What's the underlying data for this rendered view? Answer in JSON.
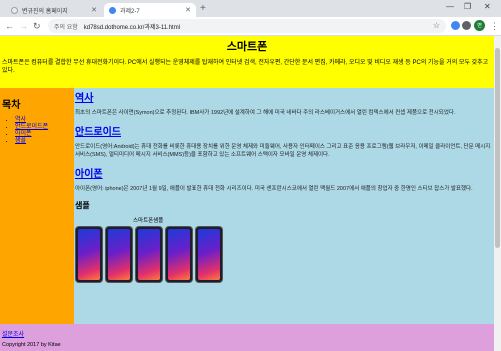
{
  "browser": {
    "tabs": [
      {
        "label": "변규진의 홈페이지",
        "active": false
      },
      {
        "label": "과제2-7",
        "active": true
      }
    ],
    "new_tab_label": "+",
    "security_label": "주의 요함",
    "url": "kd78sd.dothome.co.kr/과제3-11.html",
    "profile_initial": "변"
  },
  "page": {
    "title": "스마트폰",
    "intro": "스마트폰은 컴퓨터를 결합한 무선 휴대전화기이다. PC에서 실행되는 운영체제를 탑재하여 인터넷 검색, 전자우편, 간단한 문서 편집, 카메라, 오디오 및 비디오 재생 등 PC의 기능을 거의 모두 갖추고 있다.",
    "sidebar": {
      "heading": "목차",
      "items": [
        "역사",
        "안드로이드폰",
        "아이폰",
        "샘플"
      ]
    },
    "sections": [
      {
        "title": "역사",
        "text": "최초의 스마트폰은 사이먼(Symon)으로 추정된다. IBM사가 1992년에 설계하여 그 해에 미국 네바다 주의 라스베이거스에서 열린 컴덱스에서 컨셉 제품으로 전시되었다."
      },
      {
        "title": "안드로이드",
        "text": "안드로이드(영어:Android)는 휴대 전화를 비롯한 휴대용 장치를 위한 운영 체제와 미들웨어, 사용자 인터페이스 그리고 표준 응용 프로그램(웹 브라우저, 이메일 클라이언트, 단문 메시지 서비스(SMS), 멀티미디어 메시지 서비스(MMS)등)을 포함하고 있는 소프트웨어 스택이자 모바일 운영 체제이다."
      },
      {
        "title": "아이폰",
        "text": "아이폰(영어: iphone)은 2007년 1월 9일, 애플이 발표한 휴대 전화 시리즈이다. 미국 샌프란시스코에서 열린 맥월드 2007에서 애플의 창업자 중 한명인 스티브 잡스가 발표했다."
      }
    ],
    "sample": {
      "heading": "샘플",
      "caption": "스마트폰샘플"
    },
    "footer": {
      "link": "설문조사",
      "copyright": "Copyright 2017 by Kitae"
    }
  },
  "colors": {
    "header": "#ffff00",
    "sidebar": "#ffa500",
    "main": "#add8e6",
    "footer": "#dda0dd"
  }
}
